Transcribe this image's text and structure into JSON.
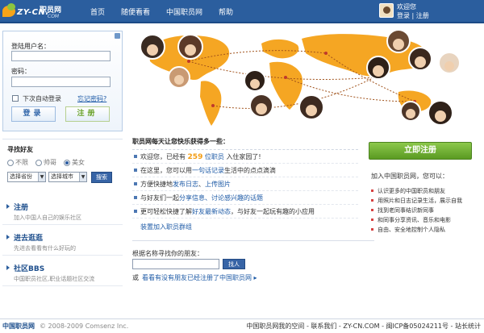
{
  "header": {
    "logo_cn": "职员网",
    "logo_brand": "ZY-CN.",
    "logo_com": "COM",
    "nav": [
      "首页",
      "随便看看",
      "中国职员网",
      "帮助"
    ],
    "welcome": "欢迎您",
    "login_link": "登录",
    "separator": "|",
    "register_link": "注册"
  },
  "login": {
    "username_label": "登陆用户名：",
    "password_label": "密码：",
    "remember": "下次自动登录",
    "forgot": "忘记密码?",
    "login_button": "登录",
    "register_button": "注册"
  },
  "finder": {
    "title": "寻找好友",
    "gender_options": [
      "不限",
      "帅哥",
      "美女"
    ],
    "selected_gender": "美女",
    "province": "选择省份",
    "city": "选择城市",
    "search": "搜索"
  },
  "sidebar": {
    "items": [
      {
        "title": "注册",
        "desc": "加入中国人自己的娱乐社区"
      },
      {
        "title": "进去逛逛",
        "desc": "先进去看看有什么好玩的"
      },
      {
        "title": "社区BBS",
        "desc": "中国职员社区,职业话题社区交流"
      }
    ]
  },
  "happy": {
    "head": "职员网每天让您快乐获得多一些：",
    "row1_pre": "欢迎您，已经有",
    "row1_num": "259",
    "row1_link": "位职员",
    "row1_post": "入住家园了!",
    "row2_pre": "在这里，您可以用",
    "row2_link": "一句话记录",
    "row2_post": "生活中的点点滴滴",
    "row3_pre": "方便快捷地",
    "row3_link1": "发布日志",
    "row3_sep": "、",
    "row3_link2": "上传图片",
    "row4_pre": "与好友们一起",
    "row4_link": "分享信息、讨论感兴趣的话题",
    "row5_pre": "更可轻松快捷了解",
    "row5_link": "好友最新动态",
    "row5_post": "，与好友一起玩有趣的小应用",
    "more": "装置加入职员群组"
  },
  "name_search": {
    "question": "根据名称寻找你的朋友：",
    "button": "找人",
    "or": "或",
    "link": "看看有没有朋友已经注册了中国职员网"
  },
  "right": {
    "register_now": "立即注册",
    "join_title": "加入中国职员网，您可以：",
    "benefits": [
      "认识更多的中国职员和朋友",
      "用照片和日志记录生活，展示自我",
      "找到老同事结识新同事",
      "和同事分享资讯、音乐和电影",
      "自由、安全地控制个人隐私"
    ]
  },
  "footer": {
    "brand": "中国职员网",
    "copyright": "© 2008-2009 Comsenz Inc.",
    "links": "中国职员网我的空间 - 联系我们 - ZY-CN.COM - 闽ICP备05024211号 - 站长统计"
  },
  "colors": {
    "nav_bg": "#2b5e9e",
    "accent_orange": "#f39c12",
    "register_green": "#6aa22a"
  }
}
